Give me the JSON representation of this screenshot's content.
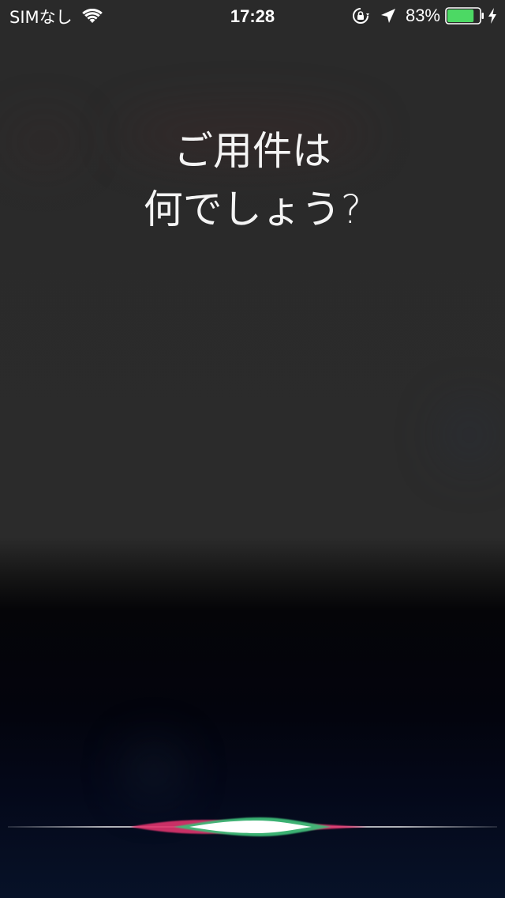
{
  "status_bar": {
    "carrier": "SIMなし",
    "time": "17:28",
    "battery_percent": "83%",
    "battery_level": 0.83,
    "icons": [
      "wifi-icon",
      "rotation-lock-icon",
      "location-icon",
      "battery-icon",
      "charging-icon"
    ]
  },
  "siri": {
    "prompt_line1": "ご用件は",
    "prompt_line2": "何でしょう?",
    "wave_colors": {
      "green": "#3dba77",
      "pink": "#e0356e",
      "center": "#ffffff"
    }
  },
  "colors": {
    "background_top": "#2a2a2a",
    "background_bottom": "#071228",
    "battery_fill": "#4cd964"
  }
}
